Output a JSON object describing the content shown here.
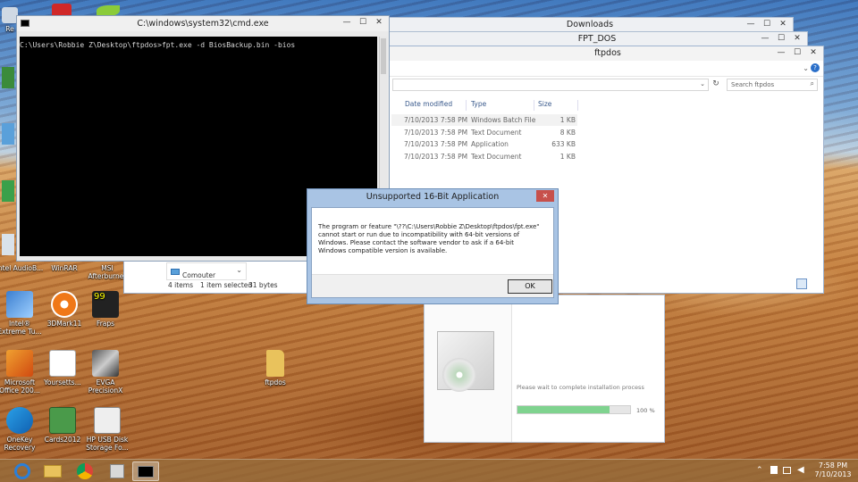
{
  "desktop_icons": [
    {
      "label": "Re",
      "x": 0
    },
    {
      "label": "Intel AudioB...",
      "x": 0
    },
    {
      "label": "WinRAR",
      "x": 0
    },
    {
      "label": "MSI Afterburner",
      "x": 0
    },
    {
      "label": "Intel® Extreme Tu...",
      "x": 0
    },
    {
      "label": "3DMark11",
      "x": 0
    },
    {
      "label": "Fraps",
      "x": 0
    },
    {
      "label": "Microsoft Office 200...",
      "x": 0
    },
    {
      "label": "Yoursetts...",
      "x": 0
    },
    {
      "label": "EVGA PrecisionX",
      "x": 0
    },
    {
      "label": "ftpdos",
      "x": 0
    },
    {
      "label": "OneKey Recovery",
      "x": 0
    },
    {
      "label": "Cards2012",
      "x": 0
    },
    {
      "label": "HP USB Disk Storage Fo...",
      "x": 0
    }
  ],
  "cmd": {
    "title": "C:\\windows\\system32\\cmd.exe",
    "line": "C:\\Users\\Robbie Z\\Desktop\\ftpdos>fpt.exe -d BiosBackup.bin -bios",
    "min": "—",
    "max": "☐",
    "close": "✕"
  },
  "downloads_window": {
    "title": "Downloads"
  },
  "fptdos_window": {
    "title": "FPT_DOS"
  },
  "explorer": {
    "title": "ftpdos",
    "search_placeholder": "Search ftpdos",
    "columns": [
      "Date modified",
      "Type",
      "Size"
    ],
    "rows": [
      {
        "date": "7/10/2013 7:58 PM",
        "type": "Windows Batch File",
        "size": "1 KB"
      },
      {
        "date": "7/10/2013 7:58 PM",
        "type": "Text Document",
        "size": "8 KB"
      },
      {
        "date": "7/10/2013 7:58 PM",
        "type": "Application",
        "size": "633 KB"
      },
      {
        "date": "7/10/2013 7:58 PM",
        "type": "Text Document",
        "size": "1 KB"
      }
    ],
    "nav_item": "Comouter",
    "status_items": "4 items",
    "status_selected": "1 item selected",
    "status_size": "31 bytes"
  },
  "dialog": {
    "title": "Unsupported 16-Bit Application",
    "message": "The program or feature \"\\??\\C:\\Users\\Robbie Z\\Desktop\\ftpdos\\fpt.exe\" cannot start or run due to incompatibility with 64-bit versions of Windows. Please contact the software vendor to ask if a 64-bit Windows compatible version is available.",
    "ok_label": "OK",
    "close": "✕"
  },
  "installer": {
    "status_text": "Please wait to complete installation process",
    "progress_label": "100 %",
    "progress": 0.82
  },
  "taskbar": {
    "time": "7:58 PM",
    "date": "7/10/2013"
  },
  "colors": {
    "dialog_titlebar": "#a9c4e4",
    "close_red": "#c7504b",
    "progress_green": "#7fd38f"
  }
}
